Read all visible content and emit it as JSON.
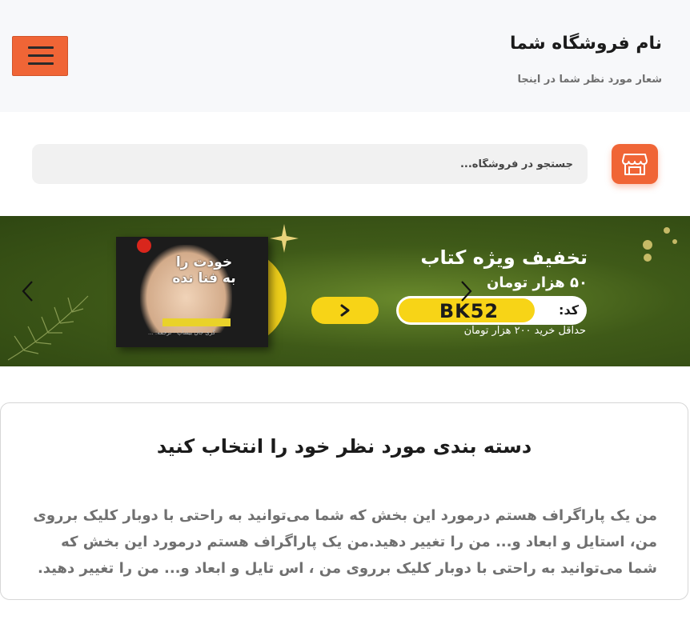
{
  "header": {
    "store_title": "نام فروشگاه شما",
    "store_slogan": "شعار مورد نظر شما در اینجا",
    "menu_icon": "hamburger-menu-icon",
    "accent_color": "#f06536"
  },
  "search": {
    "placeholder": "جستجو در فروشگاه...",
    "store_icon": "store-icon"
  },
  "banner": {
    "promo_title": "تخفیف ویژه کتاب",
    "promo_amount": "۵۰ هزار تومان",
    "coupon_label": "کد:",
    "coupon_code": "BK52",
    "min_purchase": "حداقل خرید ۲۰۰ هزار تومان",
    "book_title": "خودت را به فنا نده",
    "book_author": "گری جان بیشاپ - ترجمه: ...",
    "prev_icon": "chevron-left-icon",
    "next_icon": "chevron-right-icon",
    "go_icon": "chevron-right-icon"
  },
  "category": {
    "title": "دسته بندی مورد نظر خود را انتخاب کنید",
    "text": "من یک پاراگراف هستم درمورد این بخش که شما می‌توانید به راحتی با دوبار کلیک برروی من، استایل و ابعاد و... من را تغییر دهید.من یک پاراگراف هستم درمورد این بخش که شما می‌توانید به راحتی با دوبار کلیک برروی من ، اس تایل و ابعاد و... من را تغییر دهید."
  }
}
